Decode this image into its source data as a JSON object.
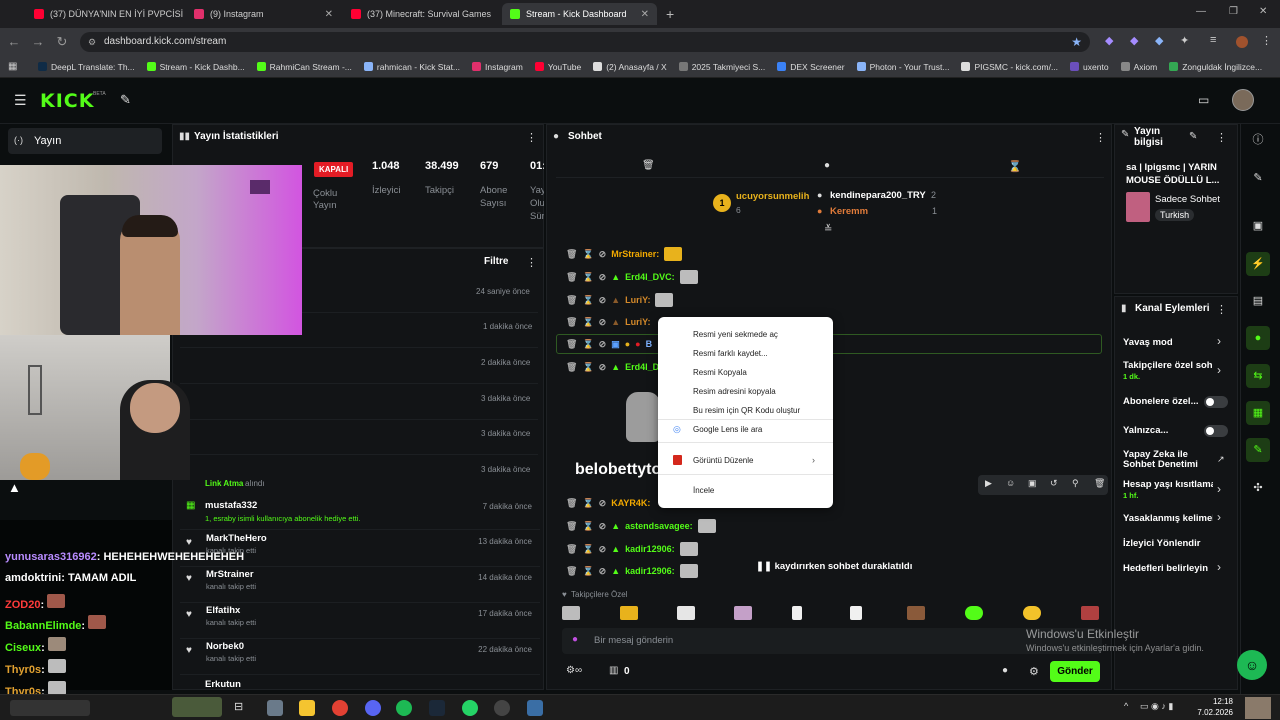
{
  "browser": {
    "tabs": [
      {
        "label": "(37) DÜNYA'NIN EN İYİ PVPCİSİ",
        "color": "#ff0033"
      },
      {
        "label": "(9) Instagram",
        "color": "#e1306c"
      },
      {
        "label": "(37) Minecraft: Survival Games",
        "color": "#ff0033"
      },
      {
        "label": "Stream - Kick Dashboard",
        "color": "#53fc18"
      }
    ],
    "url": "dashboard.kick.com/stream",
    "bookmarks": [
      "DeepL Translate: Th...",
      "Stream - Kick Dashb...",
      "RahmiCan Stream -...",
      "rahmican - Kick Stat...",
      "Instagram",
      "YouTube",
      "(2) Anasayfa / X",
      "2025 Takmiyeci S...",
      "DEX Screener",
      "Photon - Your Trust...",
      "PIGSMC - kick.com/...",
      "uxento",
      "Axiom",
      "Zonguldak İngilizce..."
    ]
  },
  "kick": {
    "logo": "KICK",
    "logo_beta": "BETA",
    "sidebar_item": "Yayın",
    "stats_panel": {
      "title": "Yayın İstatistikleri",
      "badge": "KAPALI",
      "badge_sub": "Çoklu Yayın",
      "stats": [
        {
          "value": "1.048",
          "label": "İzleyici"
        },
        {
          "value": "38.499",
          "label": "Takipçi"
        },
        {
          "value": "679",
          "label": "Abone Sayısı"
        },
        {
          "value": "01:",
          "label": "Yayın Olu Sür"
        }
      ]
    },
    "activity": {
      "filter_label": "Filtre",
      "times": [
        "24 saniye önce",
        "1 dakika önce",
        "2 dakika önce",
        "3 dakika önce",
        "3 dakika önce",
        "3 dakika önce"
      ],
      "rows": [
        {
          "name": "Link Atma",
          "sub": "alındı",
          "time": ""
        },
        {
          "name": "mustafa332",
          "sub": "1, esraby isimli kullanıcıya abonelik hediye etti.",
          "time": "7 dakika önce"
        },
        {
          "name": "MarkTheHero",
          "sub": "kanalı takip etti",
          "time": "13 dakika önce"
        },
        {
          "name": "MrStrainer",
          "sub": "kanalı takip etti",
          "time": "14 dakika önce"
        },
        {
          "name": "Elfatihx",
          "sub": "kanalı takip etti",
          "time": "17 dakika önce"
        },
        {
          "name": "Norbek0",
          "sub": "kanalı takip etti",
          "time": "22 dakika önce"
        },
        {
          "name": "Erkutun",
          "sub": "",
          "time": ""
        }
      ]
    },
    "chat": {
      "title": "Sohbet",
      "top_chatter": {
        "name": "ucuyorsunmelih",
        "count": "6"
      },
      "other_chatters": [
        {
          "name": "kendinepara200_TRY",
          "count": "2"
        },
        {
          "name": "Keremm",
          "count": "1"
        }
      ],
      "messages": [
        {
          "user": "MrStrainer:",
          "color": "#f2a900"
        },
        {
          "user": "Erd4l_DVC:",
          "color": "#53fc18"
        },
        {
          "user": "LuriY:",
          "color": "#d58a2a"
        },
        {
          "user": "LuriY:",
          "color": "#d58a2a"
        },
        {
          "user": "B",
          "color": "#7fb2ff"
        },
        {
          "user": "Erd4l_DV",
          "color": "#53fc18"
        },
        {
          "user": "KAYR4K:",
          "color": "#f2a900"
        },
        {
          "user": "astendsavagee:",
          "color": "#53fc18"
        },
        {
          "user": "kadir12906:",
          "color": "#53fc18"
        },
        {
          "user": "kadir12906:",
          "color": "#53fc18"
        }
      ],
      "big_message": "belobettyto",
      "paused_text": "kaydırırken sohbet duraklatıldı",
      "follower_emotes_label": "Takipçilere Özel",
      "input_placeholder": "Bir mesaj gönderin",
      "points": "0",
      "send_label": "Gönder"
    },
    "context_menu": {
      "items": [
        "Resmi yeni sekmede aç",
        "Resmi farklı kaydet...",
        "Resmi Kopyala",
        "Resim adresini kopyala",
        "Bu resim için QR Kodu oluştur",
        "Google Lens ile ara",
        "Görüntü Düzenle",
        "İncele"
      ]
    },
    "stream_info": {
      "title": "Yayın bilgisi",
      "stream_title": "sa | Ipigsmc | YARIN MOUSE ÖDÜLLÜ L...",
      "category": "Sadece Sohbet",
      "language": "Turkish"
    },
    "channel_actions": {
      "title": "Kanal Eylemleri",
      "rows": [
        {
          "label": "Yavaş mod",
          "sub": "",
          "kind": "chevron"
        },
        {
          "label": "Takipçilere özel soh",
          "sub": "1 dk.",
          "kind": "chevron"
        },
        {
          "label": "Abonelere özel...",
          "sub": "",
          "kind": "toggle"
        },
        {
          "label": "Yalnızca...",
          "sub": "",
          "kind": "toggle"
        },
        {
          "label": "Yapay Zeka ile Sohbet Denetimi",
          "sub": "",
          "kind": "external"
        },
        {
          "label": "Hesap yaşı kısıtlama",
          "sub": "1 hf.",
          "kind": "chevron"
        },
        {
          "label": "Yasaklanmış kelimel",
          "sub": "",
          "kind": "chevron"
        },
        {
          "label": "İzleyici Yönlendir",
          "sub": "",
          "kind": "none"
        },
        {
          "label": "Hedefleri belirleyin",
          "sub": "",
          "kind": "chevron"
        }
      ]
    }
  },
  "overlay_chat": [
    {
      "user": "yunusaras316962",
      "msg": ": HEHEHEHWEHEHEHEHEH",
      "color": "#b98cff"
    },
    {
      "user": "amdoktrini",
      "msg": ": TAMAM ADIL",
      "color": "#ffffff"
    },
    {
      "user": "ZOD20",
      "msg": ":",
      "color": "#ff3b3b"
    },
    {
      "user": "BabannElimde",
      "msg": ":",
      "color": "#53fc18"
    },
    {
      "user": "Ciseux",
      "msg": ":",
      "color": "#53fc18"
    },
    {
      "user": "Thyr0s",
      "msg": ":",
      "color": "#e0a030"
    },
    {
      "user": "Thyr0s",
      "msg": ":",
      "color": "#e0a030"
    }
  ],
  "windows": {
    "activate_title": "Windows'u Etkinleştir",
    "activate_sub": "Windows'u etkinleştirmek için Ayarlar'a gidin.",
    "time": "12:18",
    "date": "7.02.2026"
  }
}
